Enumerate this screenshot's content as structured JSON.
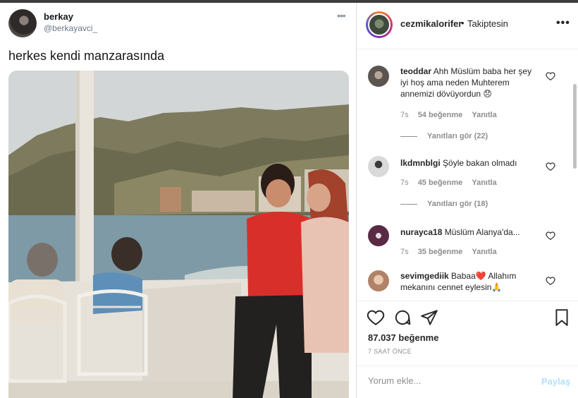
{
  "tweet": {
    "name": "berkay",
    "handle": "@berkayavci_",
    "text": "herkes kendi manzarasında",
    "more_icon": "ellipsis-icon"
  },
  "instagram": {
    "username": "cezmikalorifer",
    "separator": "•",
    "follow_status": "Takiptesin",
    "comments": [
      {
        "user": "teoddar",
        "text": "Ahh Müslüm baba her şey iyi hoş ama neden Muhterem annemizi dövüyordun 😞",
        "time": "7s",
        "likes": "54 beğenme",
        "reply": "Yanıtla",
        "view_replies": "Yanıtları gör (22)"
      },
      {
        "user": "lkdmnblgi",
        "text": "Şöyle bakan olmadı",
        "time": "7s",
        "likes": "45 beğenme",
        "reply": "Yanıtla",
        "view_replies": "Yanıtları gör (18)"
      },
      {
        "user": "nurayca18",
        "text": "Müslüm Alanya'da...",
        "time": "7s",
        "likes": "35 beğenme",
        "reply": "Yanıtla"
      },
      {
        "user": "sevimgediik",
        "text": "Babaa❤️ Allahım mekanını cennet eylesin🙏"
      }
    ],
    "like_count": "87.037 beğenme",
    "timestamp": "7 SAAT ÖNCE",
    "comment_placeholder": "Yorum ekle...",
    "post_label": "Paylaş"
  },
  "colors": {
    "link_disabled": "#b2dffc",
    "meta_gray": "#8e8e8e",
    "text": "#262626"
  }
}
